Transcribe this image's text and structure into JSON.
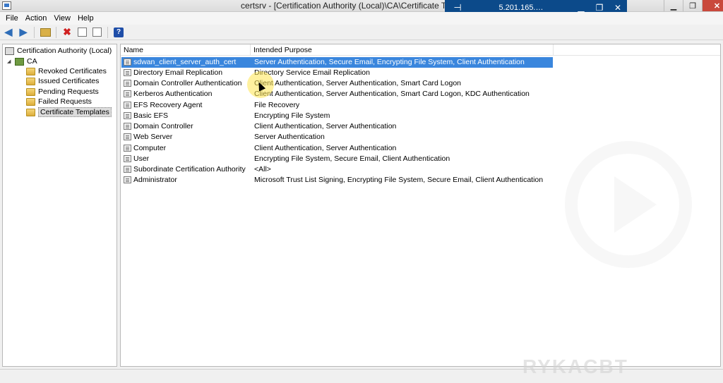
{
  "window": {
    "title": "certsrv - [Certification Authority (Local)\\CA\\Certificate Templates]"
  },
  "rdp_bar": {
    "host": "5.201.165.…"
  },
  "menu": [
    "File",
    "Action",
    "View",
    "Help"
  ],
  "tree": {
    "root": "Certification Authority (Local)",
    "ca": "CA",
    "children": [
      "Revoked Certificates",
      "Issued Certificates",
      "Pending Requests",
      "Failed Requests",
      "Certificate Templates"
    ]
  },
  "list": {
    "columns": [
      "Name",
      "Intended Purpose"
    ],
    "rows": [
      {
        "name": "sdwan_client_server_auth_cert",
        "purpose": "Server Authentication, Secure Email, Encrypting File System, Client Authentication"
      },
      {
        "name": "Directory Email Replication",
        "purpose": "Directory Service Email Replication"
      },
      {
        "name": "Domain Controller Authentication",
        "purpose": "Client Authentication, Server Authentication, Smart Card Logon"
      },
      {
        "name": "Kerberos Authentication",
        "purpose": "Client Authentication, Server Authentication, Smart Card Logon, KDC Authentication"
      },
      {
        "name": "EFS Recovery Agent",
        "purpose": "File Recovery"
      },
      {
        "name": "Basic EFS",
        "purpose": "Encrypting File System"
      },
      {
        "name": "Domain Controller",
        "purpose": "Client Authentication, Server Authentication"
      },
      {
        "name": "Web Server",
        "purpose": "Server Authentication"
      },
      {
        "name": "Computer",
        "purpose": "Client Authentication, Server Authentication"
      },
      {
        "name": "User",
        "purpose": "Encrypting File System, Secure Email, Client Authentication"
      },
      {
        "name": "Subordinate Certification Authority",
        "purpose": "<All>"
      },
      {
        "name": "Administrator",
        "purpose": "Microsoft Trust List Signing, Encrypting File System, Secure Email, Client Authentication"
      }
    ]
  },
  "watermark": "RYKACBT",
  "colors": {
    "selection": "#3a86dd",
    "rdp_bar": "#0c4a8a",
    "close_button": "#c9493c"
  }
}
